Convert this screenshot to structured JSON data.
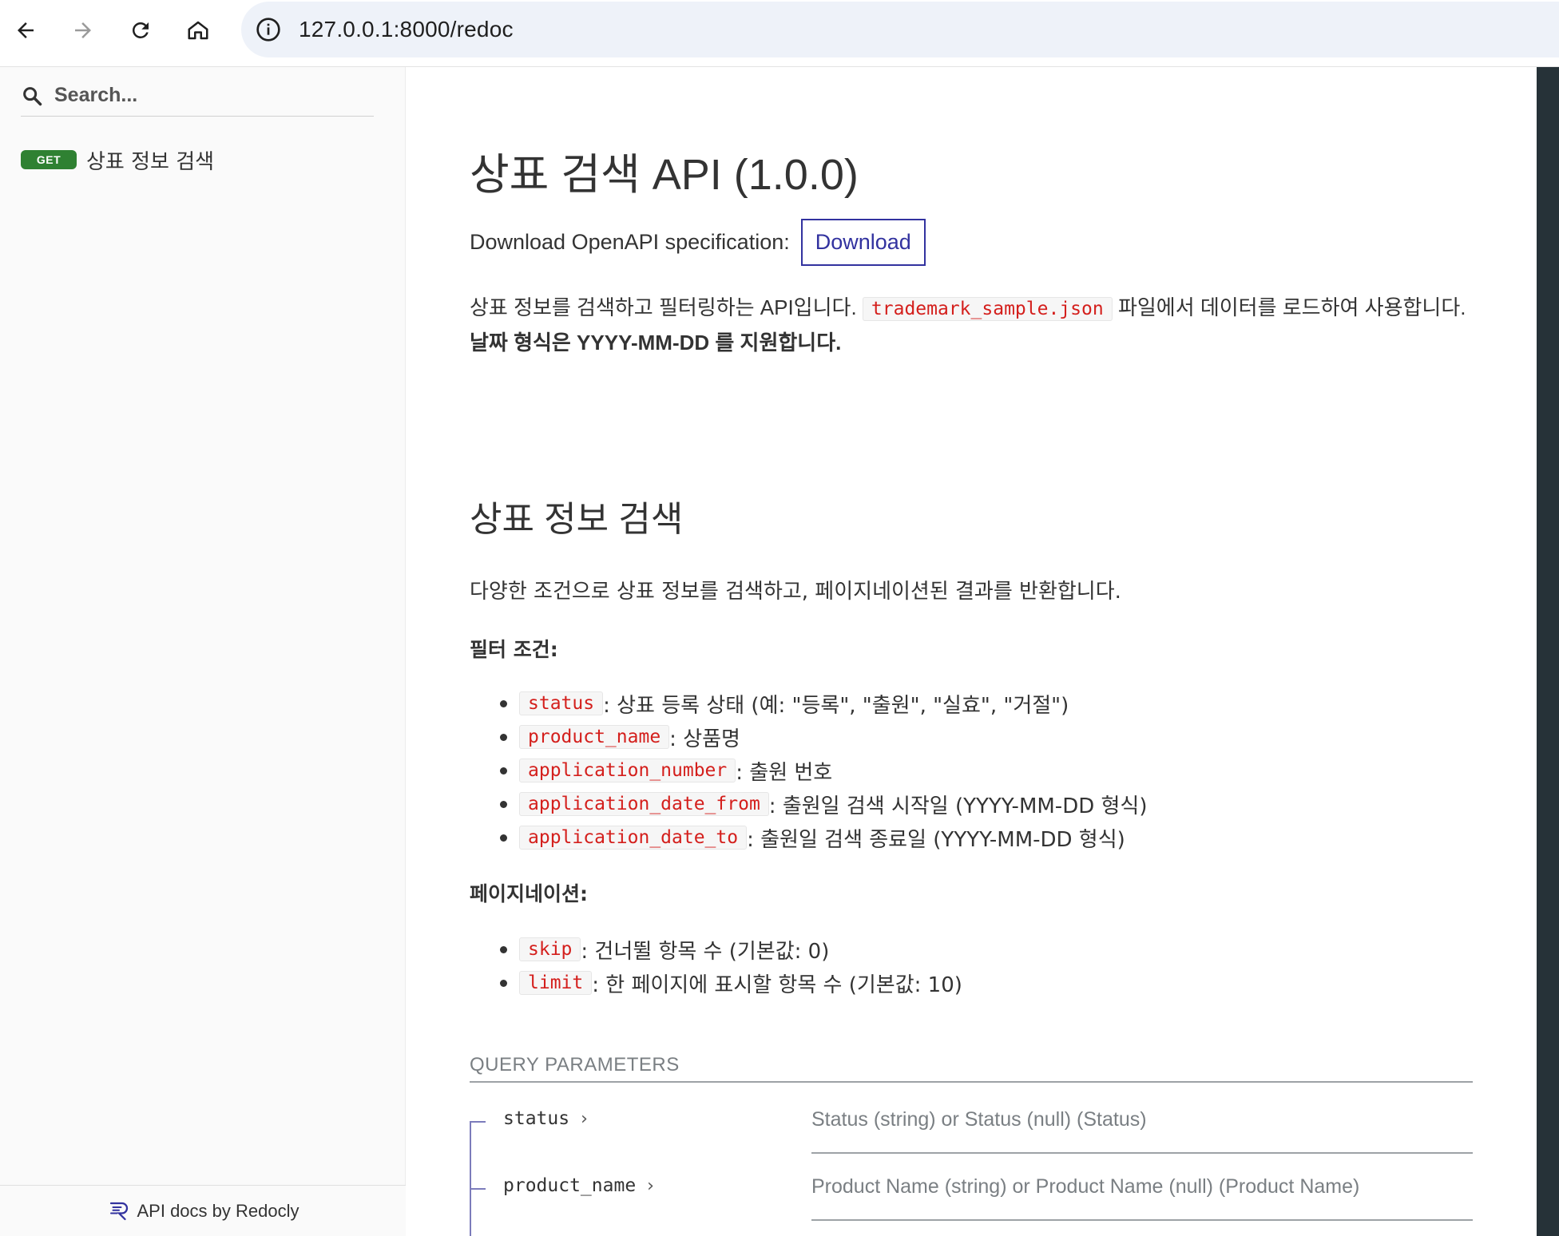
{
  "browser": {
    "back_icon": "arrow-left-icon",
    "forward_icon": "arrow-right-icon",
    "reload_icon": "reload-icon",
    "home_icon": "home-icon",
    "info_icon": "info-icon",
    "url": "127.0.0.1:8000/redoc"
  },
  "sidebar": {
    "search_placeholder": "Search...",
    "items": [
      {
        "method": "GET",
        "label": "상표 정보 검색"
      }
    ],
    "footer": "API docs by Redocly"
  },
  "api": {
    "title": "상표 검색 API (1.0.0)",
    "download_label": "Download OpenAPI specification:",
    "download_button": "Download",
    "desc_pre": "상표 정보를 검색하고 필터링하는 API입니다.",
    "desc_code": "trademark_sample.json",
    "desc_post": "파일에서 데이터를 로드하여 사용합니다.",
    "desc_bold": "날짜 형식은 YYYY-MM-DD 를 지원합니다."
  },
  "operation": {
    "title": "상표 정보 검색",
    "description": "다양한 조건으로 상표 정보를 검색하고, 페이지네이션된 결과를 반환합니다.",
    "filter_heading": "필터 조건:",
    "filters": [
      {
        "code": "status",
        "text": ": 상표 등록 상태 (예: \"등록\", \"출원\", \"실효\", \"거절\")"
      },
      {
        "code": "product_name",
        "text": ": 상품명"
      },
      {
        "code": "application_number",
        "text": ": 출원 번호"
      },
      {
        "code": "application_date_from",
        "text": ": 출원일 검색 시작일 (YYYY-MM-DD 형식)"
      },
      {
        "code": "application_date_to",
        "text": ": 출원일 검색 종료일 (YYYY-MM-DD 형식)"
      }
    ],
    "pagination_heading": "페이지네이션:",
    "pagination": [
      {
        "code": "skip",
        "text": ": 건너뛸 항목 수 (기본값: 0)"
      },
      {
        "code": "limit",
        "text": ": 한 페이지에 표시할 항목 수 (기본값: 10)"
      }
    ],
    "query_params_heading": "QUERY PARAMETERS",
    "params": [
      {
        "name": "status",
        "type": "Status (string) or Status (null) (Status)"
      },
      {
        "name": "product_name",
        "type": "Product Name (string) or Product Name (null) (Product Name)"
      }
    ]
  },
  "colors": {
    "get_badge": "#2f8132",
    "link_blue": "#32329f",
    "code_red": "#d41f1c",
    "dark_strip": "#263238"
  }
}
